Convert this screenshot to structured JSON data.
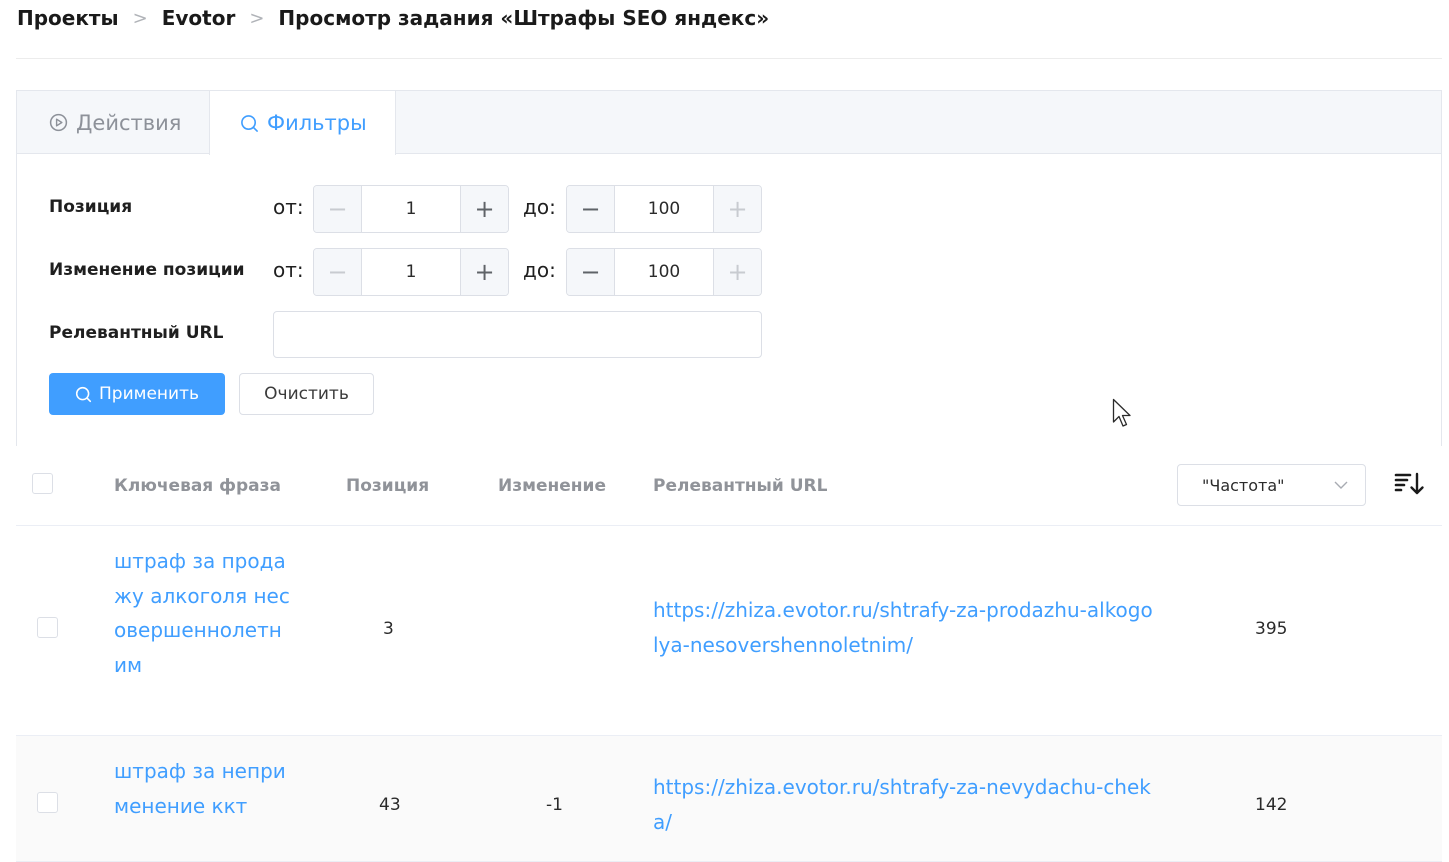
{
  "breadcrumb": {
    "items": [
      "Проекты",
      "Evotor",
      "Просмотр задания «Штрафы SEO яндекс»"
    ]
  },
  "tabs": {
    "actions_label": "Действия",
    "filters_label": "Фильтры",
    "active": "filters"
  },
  "filters": {
    "position": {
      "label": "Позиция",
      "from_label": "от:",
      "to_label": "до:",
      "from_value": "1",
      "to_value": "100"
    },
    "change": {
      "label": "Изменение позиции",
      "from_label": "от:",
      "to_label": "до:",
      "from_value": "1",
      "to_value": "100"
    },
    "url": {
      "label": "Релевантный URL",
      "value": "",
      "placeholder": ""
    },
    "apply_label": "Применить",
    "clear_label": "Очистить"
  },
  "table": {
    "headers": {
      "keyword": "Ключевая фраза",
      "position": "Позиция",
      "change": "Изменение",
      "url": "Релевантный URL"
    },
    "sort_select": "\"Частота\"",
    "rows": [
      {
        "keyword": "штраф за продажу алкоголя несовершеннолетним",
        "position": "3",
        "change": "",
        "url": "https://zhiza.evotor.ru/shtrafy-za-prodazhu-alkogolya-nesovershennoletnim/",
        "frequency": "395"
      },
      {
        "keyword": "штраф за неприменение ккт",
        "position": "43",
        "change": "-1",
        "url": "https://zhiza.evotor.ru/shtrafy-za-nevydachu-cheka/",
        "frequency": "142"
      }
    ]
  },
  "colors": {
    "accent": "#409eff",
    "header_text": "#909399",
    "border": "#dcdfe6"
  },
  "icons": {
    "actions_tab": "play-circle-icon",
    "filters_tab": "search-icon",
    "apply": "search-icon",
    "sort_select": "chevron-down-icon",
    "sort_order": "sort-descending-icon"
  }
}
